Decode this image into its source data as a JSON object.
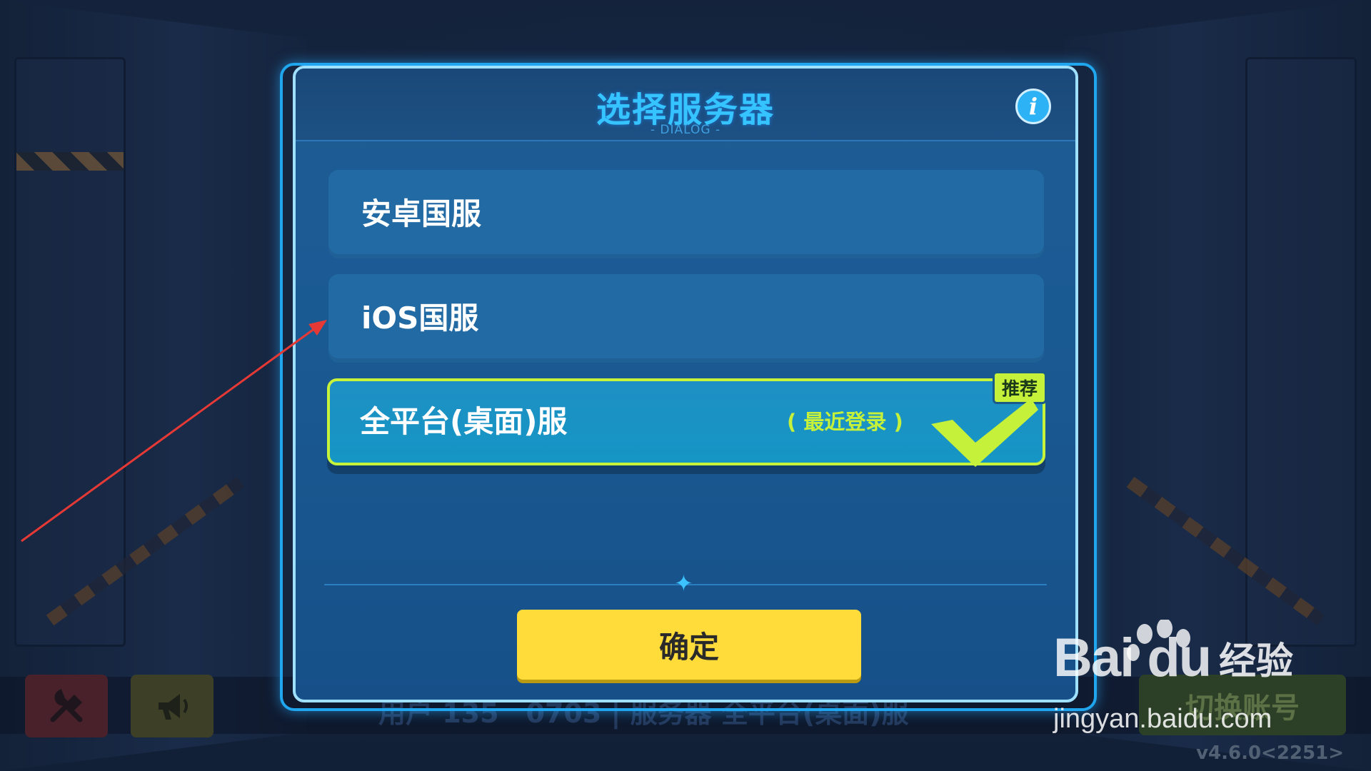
{
  "dialog": {
    "title": "选择服务器",
    "subtitle": "- DIALOG -",
    "info_icon": "i",
    "servers": [
      {
        "label": "安卓国服",
        "selected": false
      },
      {
        "label": "iOS国服",
        "selected": false
      },
      {
        "label": "全平台(桌面)服",
        "selected": true,
        "note": "( 最近登录 )",
        "badge": "推荐"
      }
    ],
    "confirm_label": "确定"
  },
  "background": {
    "account_line": "用户 135　0703 | 服务器 全平台(桌面)服",
    "switch_account_label": "切换账号",
    "version": "v4.6.0<2251>",
    "tool_icons": [
      "wrench-hammer-icon",
      "megaphone-icon"
    ]
  },
  "watermark": {
    "brand": "Bai du",
    "name": "经验",
    "url": "jingyan.baidu.com"
  },
  "colors": {
    "accent_cyan": "#35c4ff",
    "selected_green": "#c6f13a",
    "confirm_yellow": "#ffdc3a",
    "dialog_blue": "#1f5c95",
    "annotation_red": "#e53935"
  }
}
